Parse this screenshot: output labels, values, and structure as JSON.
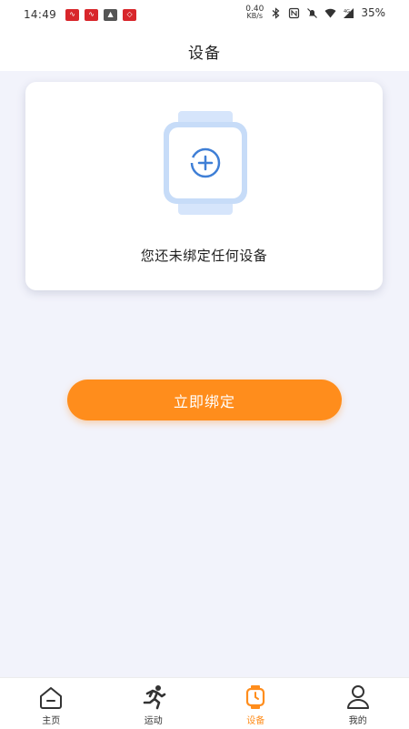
{
  "status_bar": {
    "time": "14:49",
    "net_speed_value": "0.40",
    "net_speed_unit": "KB/s",
    "network_type": "4G",
    "battery": "35%",
    "notification_icons": [
      "app-notification-icon",
      "app-notification-icon",
      "image-notification-icon",
      "app-notification-icon"
    ]
  },
  "header": {
    "title": "设备"
  },
  "device_card": {
    "empty_text": "您还未绑定任何设备",
    "icon": "watch-add-icon"
  },
  "bind_button": {
    "label": "立即绑定"
  },
  "tabs": [
    {
      "label": "主页",
      "icon": "home-icon",
      "active": false
    },
    {
      "label": "运动",
      "icon": "running-icon",
      "active": false
    },
    {
      "label": "设备",
      "icon": "watch-icon",
      "active": true
    },
    {
      "label": "我的",
      "icon": "user-icon",
      "active": false
    }
  ],
  "colors": {
    "accent": "#ff8d1c",
    "watch_blue": "#aac8f2",
    "background": "#f2f3fb"
  }
}
